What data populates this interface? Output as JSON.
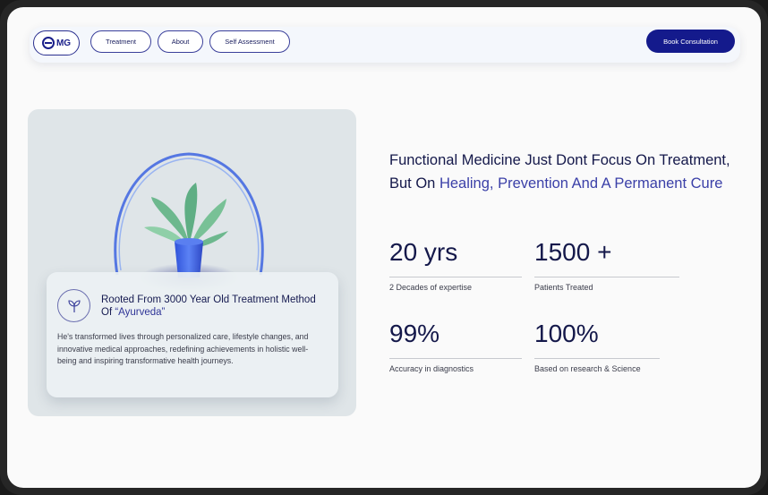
{
  "logo": {
    "text": "MG"
  },
  "nav": {
    "treatment": "Treatment",
    "about": "About",
    "self_assessment": "Self Assessment",
    "book": "Book Consultation"
  },
  "info_card": {
    "title_main": "Rooted From 3000 Year Old Treatment Method Of ",
    "title_accent": "“Ayurveda”",
    "description": "He's transformed lives through personalized care, lifestyle changes, and innovative medical approaches, redefining achievements in holistic well-being and inspiring transformative health journeys."
  },
  "headline": {
    "main": "Functional Medicine Just Dont Focus On Treatment, But On ",
    "accent": "Healing, Prevention And A Permanent Cure"
  },
  "stats": [
    {
      "value": "20 yrs",
      "label": "2 Decades of expertise"
    },
    {
      "value": "1500 +",
      "label": "Patients Treated"
    },
    {
      "value": "99%",
      "label": "Accuracy in diagnostics"
    },
    {
      "value": "100%",
      "label": "Based on research & Science"
    }
  ],
  "colors": {
    "brand": "#141a8c",
    "accent": "#3b40a8",
    "text": "#14184a"
  },
  "icons": {
    "logo": "mg-logo-icon",
    "sprout": "sprout-icon",
    "plant": "plant-in-glass-dome-illustration"
  }
}
